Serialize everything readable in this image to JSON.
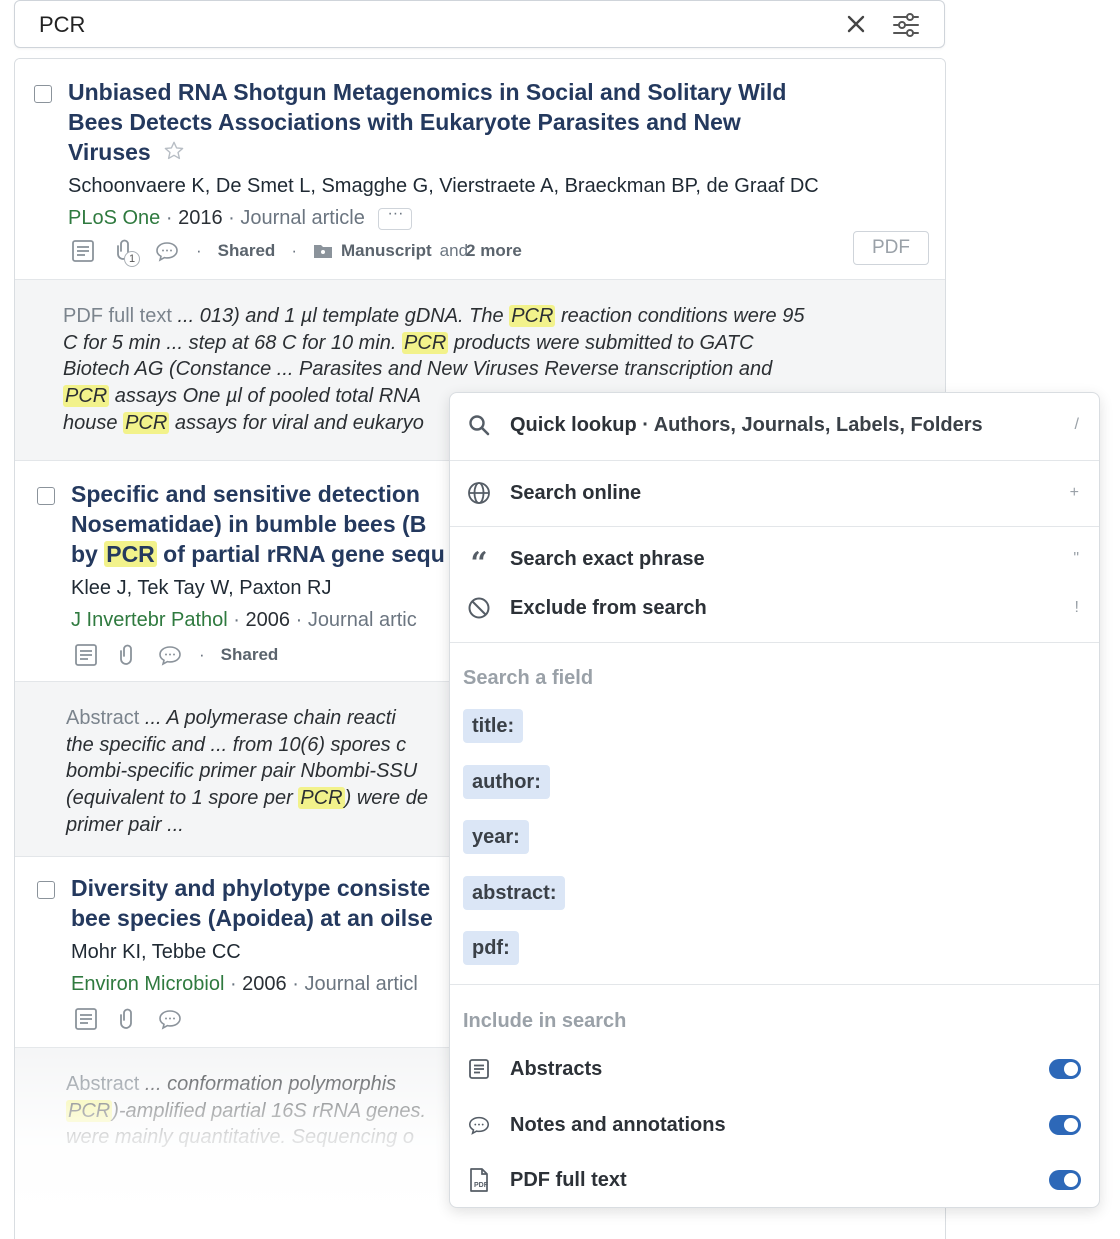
{
  "search": {
    "query": "PCR"
  },
  "results": [
    {
      "title_lines": [
        "Unbiased RNA Shotgun Metagenomics in Social and Solitary Wild",
        "Bees Detects Associations with Eukaryote Parasites and New",
        "Viruses"
      ],
      "authors": "Schoonvaere K, De Smet L, Smagghe G, Vierstraete A, Braeckman BP, de Graaf DC",
      "journal": "PLoS One",
      "year": "2016",
      "type": "Journal article",
      "attachment_count": "1",
      "shared": "Shared",
      "folder": "Manuscript",
      "folder_more_and": "and",
      "folder_more": "2 more",
      "pdf_label": "PDF",
      "snippet_label": "PDF full text",
      "snippet_lines": [
        [
          "...  013) and 1 µl template gDNA. The ",
          "PCR",
          " reaction conditions were 95"
        ],
        [
          "C for 5 min  ...  step at 68 C for 10 min. ",
          "PCR",
          " products were submitted to GATC"
        ],
        [
          "Biotech AG (Constance  ...  Parasites and New Viruses Reverse transcription and"
        ],
        [
          "",
          "PCR",
          " assays One µl of pooled total RNA"
        ],
        [
          "house ",
          "PCR",
          " assays for viral and eukaryo"
        ]
      ]
    },
    {
      "title_lines": [
        "Specific and sensitive detection",
        "Nosematidae) in bumble bees (B",
        "by "
      ],
      "title_hl": "PCR",
      "title_tail": " of partial rRNA gene sequ",
      "authors": "Klee J, Tek Tay W, Paxton RJ",
      "journal": "J Invertebr Pathol",
      "year": "2006",
      "type": "Journal artic",
      "shared": "Shared",
      "snippet_label": "Abstract",
      "snippet_lines": [
        [
          "...  A polymerase chain reacti"
        ],
        [
          "the specific and  ...  from 10(6) spores c"
        ],
        [
          "bombi-specific primer pair Nbombi-SSU"
        ],
        [
          "(equivalent to 1 spore per ",
          "PCR",
          ") were de"
        ],
        [
          "primer pair  ..."
        ]
      ]
    },
    {
      "title_lines": [
        "Diversity and phylotype consiste",
        "bee species (Apoidea) at an oilse"
      ],
      "authors": "Mohr KI, Tebbe CC",
      "journal": "Environ Microbiol",
      "year": "2006",
      "type": "Journal articl",
      "snippet_label": "Abstract",
      "snippet_lines": [
        [
          "...  conformation polymorphis"
        ],
        [
          "",
          "PCR",
          ")-amplified partial 16S rRNA genes."
        ],
        [
          "were mainly quantitative. Sequencing o"
        ]
      ]
    }
  ],
  "dropdown": {
    "quick_lookup": "Quick lookup",
    "quick_lookup_sub": "· Authors, Journals, Labels, Folders",
    "quick_lookup_shortcut": "/",
    "search_online": "Search online",
    "search_online_shortcut": "+",
    "exact_phrase": "Search exact phrase",
    "exact_phrase_shortcut": "\"",
    "exclude": "Exclude from search",
    "exclude_shortcut": "!",
    "field_heading": "Search a field",
    "fields": [
      "title:",
      "author:",
      "year:",
      "abstract:",
      "pdf:"
    ],
    "include_heading": "Include in search",
    "include": [
      {
        "label": "Abstracts",
        "on": true
      },
      {
        "label": "Notes and annotations",
        "on": true
      },
      {
        "label": "PDF full text",
        "on": true
      }
    ],
    "pdf_icon_text": "PDF"
  },
  "colors": {
    "title": "#24395e",
    "journal": "#2f7a3f",
    "highlight": "#f2f28b",
    "chip": "#dbe6f6",
    "toggle": "#2d68b8"
  }
}
